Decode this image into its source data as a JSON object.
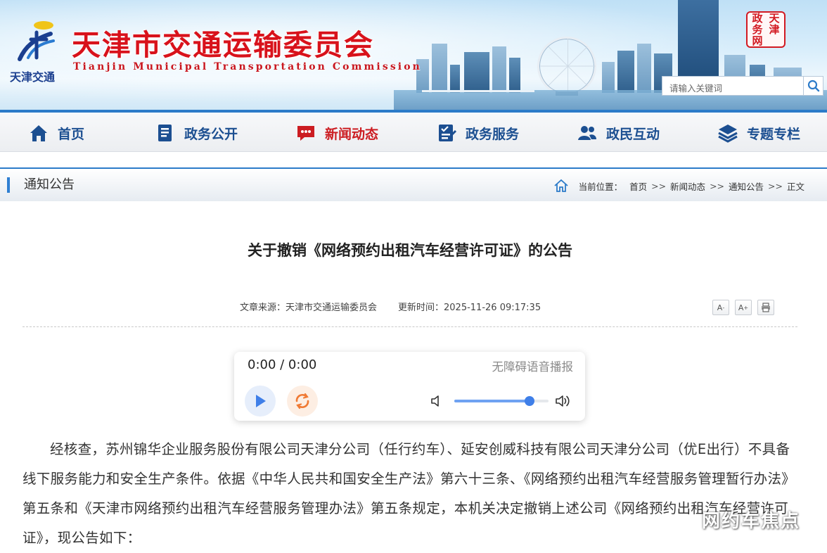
{
  "header": {
    "logo_text": "天津交通",
    "site_title": "天津市交通运输委员会",
    "site_subtitle": "Tianjin Municipal Transportation Commission",
    "stamp_chars": [
      "政",
      "天",
      "务",
      "津",
      "网",
      ""
    ],
    "search_placeholder": "请输入关键词"
  },
  "nav": {
    "items": [
      {
        "label": "首页",
        "icon": "home-icon"
      },
      {
        "label": "政务公开",
        "icon": "document-icon"
      },
      {
        "label": "新闻动态",
        "icon": "chat-icon",
        "active": true
      },
      {
        "label": "政务服务",
        "icon": "form-icon"
      },
      {
        "label": "政民互动",
        "icon": "users-icon"
      },
      {
        "label": "专题专栏",
        "icon": "layers-icon"
      }
    ]
  },
  "location": {
    "section_title": "通知公告",
    "prefix": "当前位置：",
    "crumbs": [
      "首页",
      "新闻动态",
      "通知公告",
      "正文"
    ],
    "separator": ">>"
  },
  "article": {
    "title": "关于撤销《网络预约出租汽车经营许可证》的公告",
    "source": "文章来源：天津市交通运输委员会",
    "updated": "更新时间：2025-11-26 09:17:35",
    "font_small": "A",
    "font_large": "A",
    "minus": "-",
    "plus": "+",
    "body": "经核查，苏州锦华企业服务股份有限公司天津分公司（任行约车）、延安创威科技有限公司天津分公司（优E出行）不具备线下服务能力和安全生产条件。依据《中华人民共和国安全生产法》第六十三条、《网络预约出租汽车经营服务管理暂行办法》第五条和《天津市网络预约出租汽车经营服务管理办法》第五条规定，本机关决定撤销上述公司《网络预约出租汽车经营许可证》，现公告如下："
  },
  "player": {
    "time": "0:00 / 0:00",
    "label": "无障碍语音播报",
    "volume": 0.8
  },
  "watermark": "网约车焦点",
  "colors": {
    "title_red": "#d8121b",
    "nav_blue": "#1c4f91",
    "nav_active": "#cc1d22",
    "accent_blue": "#2c7bc9"
  }
}
